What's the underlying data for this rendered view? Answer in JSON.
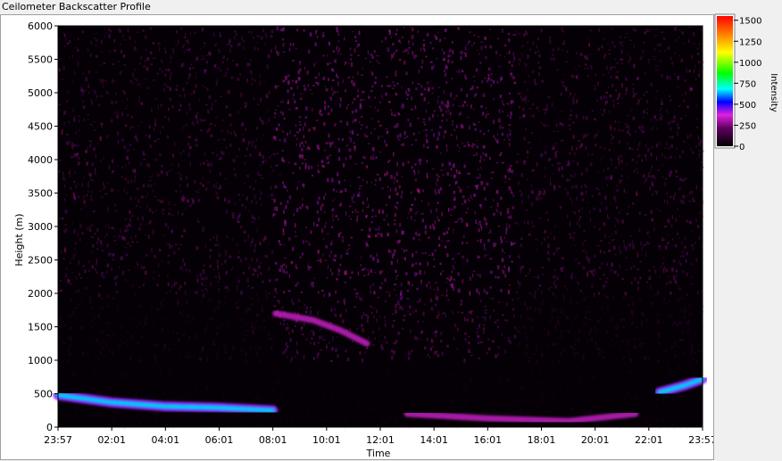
{
  "window_title": "Ceilometer Backscatter Profile",
  "chart_data": {
    "type": "heatmap",
    "title": "",
    "xlabel": "Time",
    "ylabel": "Height (m)",
    "x_ticks": [
      "23:57",
      "02:01",
      "04:01",
      "06:01",
      "08:01",
      "10:01",
      "12:01",
      "14:01",
      "16:01",
      "18:01",
      "20:01",
      "22:01",
      "23:57"
    ],
    "y_ticks": [
      0,
      500,
      1000,
      1500,
      2000,
      2500,
      3000,
      3500,
      4000,
      4500,
      5000,
      5500,
      6000
    ],
    "ylim": [
      0,
      6000
    ],
    "colorbar": {
      "label": "Intensity",
      "ticks": [
        0,
        250,
        500,
        750,
        1000,
        1250,
        1500
      ],
      "range": [
        0,
        1550
      ]
    },
    "features": [
      {
        "name": "boundary layer",
        "intensity": 600,
        "points": [
          [
            0,
            480
          ],
          [
            2,
            370
          ],
          [
            4,
            310
          ],
          [
            6,
            290
          ],
          [
            8,
            250
          ]
        ]
      },
      {
        "name": "cloud layer",
        "intensity": 200,
        "points": [
          [
            8.1,
            1700
          ],
          [
            9.5,
            1600
          ],
          [
            10.5,
            1450
          ],
          [
            11.5,
            1250
          ]
        ]
      },
      {
        "name": "low layer",
        "intensity": 150,
        "points": [
          [
            13,
            200
          ],
          [
            16,
            130
          ],
          [
            19,
            90
          ],
          [
            21.5,
            200
          ]
        ]
      },
      {
        "name": "evening layer",
        "intensity": 600,
        "points": [
          [
            22.4,
            520
          ],
          [
            23.3,
            620
          ],
          [
            24,
            720
          ]
        ]
      }
    ]
  }
}
